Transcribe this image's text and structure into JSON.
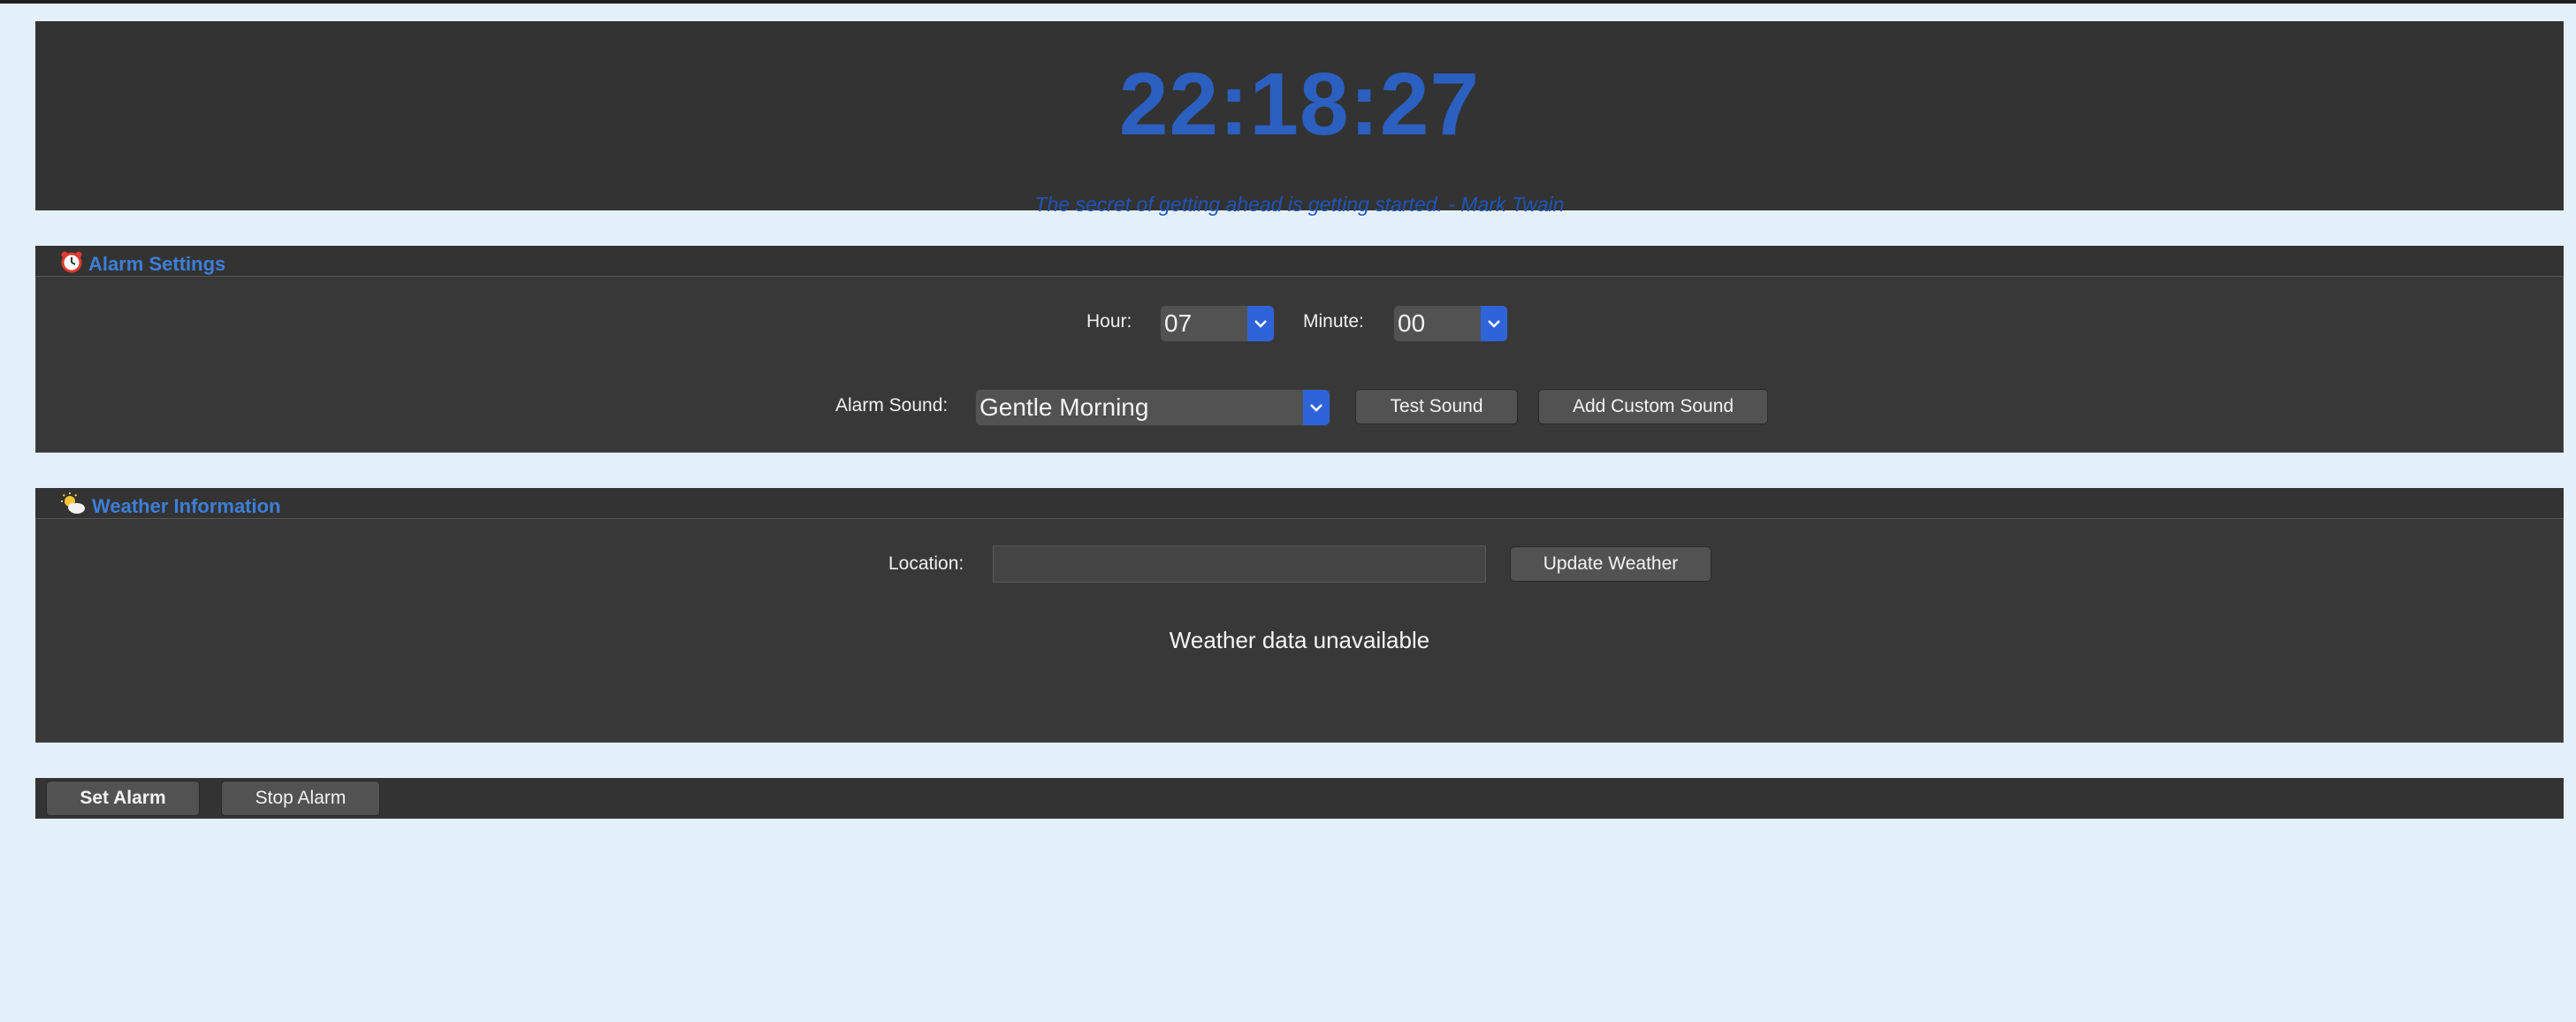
{
  "clock": {
    "time": "22:18:27",
    "quote": "The secret of getting ahead is getting started. - Mark Twain"
  },
  "alarm": {
    "title": "Alarm Settings",
    "icon": "alarm-clock-icon",
    "hour_label": "Hour:",
    "hour_value": "07",
    "minute_label": "Minute:",
    "minute_value": "00",
    "sound_label": "Alarm Sound:",
    "sound_value": "Gentle Morning",
    "test_sound": "Test Sound",
    "add_custom_sound": "Add Custom Sound"
  },
  "weather": {
    "title": "Weather Information",
    "icon": "sun-cloud-icon",
    "location_label": "Location:",
    "location_value": "",
    "update_button": "Update Weather",
    "status": "Weather data unavailable"
  },
  "actions": {
    "set_alarm": "Set Alarm",
    "stop_alarm": "Stop Alarm"
  },
  "colors": {
    "background": "#e4f0f9",
    "panel": "#333333",
    "accent": "#2b5fc0",
    "title": "#3d7fd8",
    "select_arrow": "#2f63d9"
  }
}
